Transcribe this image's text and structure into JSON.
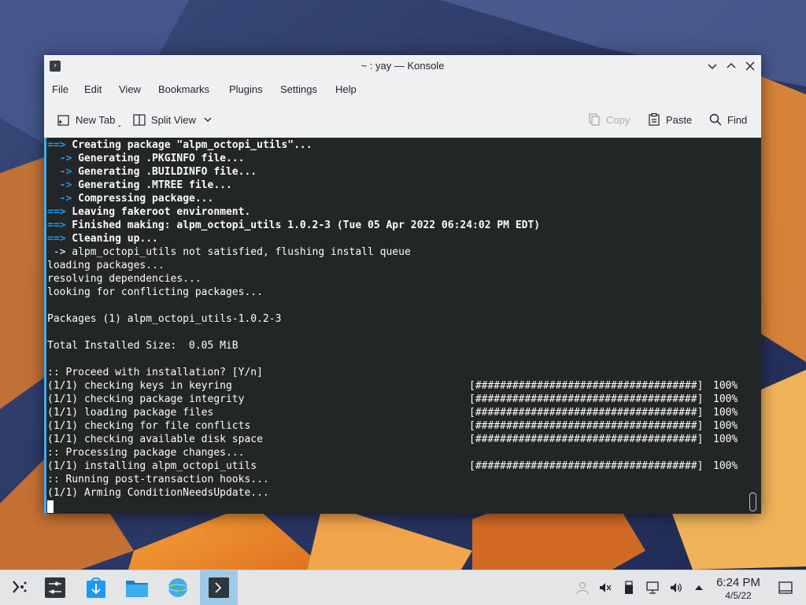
{
  "window": {
    "title": "~ : yay — Konsole"
  },
  "menubar": {
    "items": [
      "File",
      "Edit",
      "View",
      "Bookmarks",
      "Plugins",
      "Settings",
      "Help"
    ]
  },
  "toolbar": {
    "new_tab_label": "New Tab",
    "split_view_label": "Split View",
    "copy_label": "Copy",
    "paste_label": "Paste",
    "find_label": "Find"
  },
  "terminal": {
    "lines": [
      {
        "prefix": "==>",
        "text": " Creating package \"alpm_octopi_utils\"...",
        "style": "big"
      },
      {
        "prefix": "  ->",
        "text": " Generating .PKGINFO file...",
        "style": "small"
      },
      {
        "prefix": "  ->",
        "text": " Generating .BUILDINFO file...",
        "style": "small"
      },
      {
        "prefix": "  ->",
        "text": " Generating .MTREE file...",
        "style": "small"
      },
      {
        "prefix": "  ->",
        "text": " Compressing package...",
        "style": "small"
      },
      {
        "prefix": "==>",
        "text": " Leaving fakeroot environment.",
        "style": "big"
      },
      {
        "prefix": "==>",
        "text": " Finished making: alpm_octopi_utils 1.0.2-3 (Tue 05 Apr 2022 06:24:02 PM EDT)",
        "style": "big"
      },
      {
        "prefix": "==>",
        "text": " Cleaning up...",
        "style": "big"
      },
      {
        "prefix": " ->",
        "text": " alpm_octopi_utils not satisfied, flushing install queue",
        "style": "plain-arrow"
      },
      {
        "prefix": "",
        "text": "loading packages...",
        "style": "plain"
      },
      {
        "prefix": "",
        "text": "resolving dependencies...",
        "style": "plain"
      },
      {
        "prefix": "",
        "text": "looking for conflicting packages...",
        "style": "plain"
      },
      {
        "prefix": "",
        "text": "",
        "style": "plain"
      },
      {
        "prefix": "",
        "text": "Packages (1) alpm_octopi_utils-1.0.2-3",
        "style": "plain"
      },
      {
        "prefix": "",
        "text": "",
        "style": "plain"
      },
      {
        "prefix": "",
        "text": "Total Installed Size:  0.05 MiB",
        "style": "plain"
      },
      {
        "prefix": "",
        "text": "",
        "style": "plain"
      },
      {
        "prefix": "",
        "text": ":: Proceed with installation? [Y/n]",
        "style": "plain"
      },
      {
        "prefix": "",
        "text": "(1/1) checking keys in keyring",
        "style": "plain",
        "bar": "[####################################]",
        "pct": "100%"
      },
      {
        "prefix": "",
        "text": "(1/1) checking package integrity",
        "style": "plain",
        "bar": "[####################################]",
        "pct": "100%"
      },
      {
        "prefix": "",
        "text": "(1/1) loading package files",
        "style": "plain",
        "bar": "[####################################]",
        "pct": "100%"
      },
      {
        "prefix": "",
        "text": "(1/1) checking for file conflicts",
        "style": "plain",
        "bar": "[####################################]",
        "pct": "100%"
      },
      {
        "prefix": "",
        "text": "(1/1) checking available disk space",
        "style": "plain",
        "bar": "[####################################]",
        "pct": "100%"
      },
      {
        "prefix": "",
        "text": ":: Processing package changes...",
        "style": "plain"
      },
      {
        "prefix": "",
        "text": "(1/1) installing alpm_octopi_utils",
        "style": "plain",
        "bar": "[####################################]",
        "pct": "100%"
      },
      {
        "prefix": "",
        "text": ":: Running post-transaction hooks...",
        "style": "plain"
      },
      {
        "prefix": "",
        "text": "(1/1) Arming ConditionNeedsUpdate...",
        "style": "plain"
      }
    ]
  },
  "taskbar": {
    "apps": [
      {
        "icon": "application-launcher-icon"
      },
      {
        "icon": "system-settings-icon"
      },
      {
        "icon": "discover-icon"
      },
      {
        "icon": "file-manager-icon"
      },
      {
        "icon": "web-browser-icon"
      },
      {
        "icon": "konsole-icon",
        "active": true
      }
    ],
    "tray": [
      "user-icon",
      "volume-muted-icon",
      "usb-icon",
      "network-icon",
      "volume-icon",
      "arrow-up-icon"
    ],
    "clock_time": "6:24 PM",
    "clock_date": "4/5/22"
  },
  "colors": {
    "accent": "#3daee9",
    "arrow": "#1d99f3",
    "terminal_bg": "#232627",
    "terminal_fg": "#fcfcfc"
  }
}
